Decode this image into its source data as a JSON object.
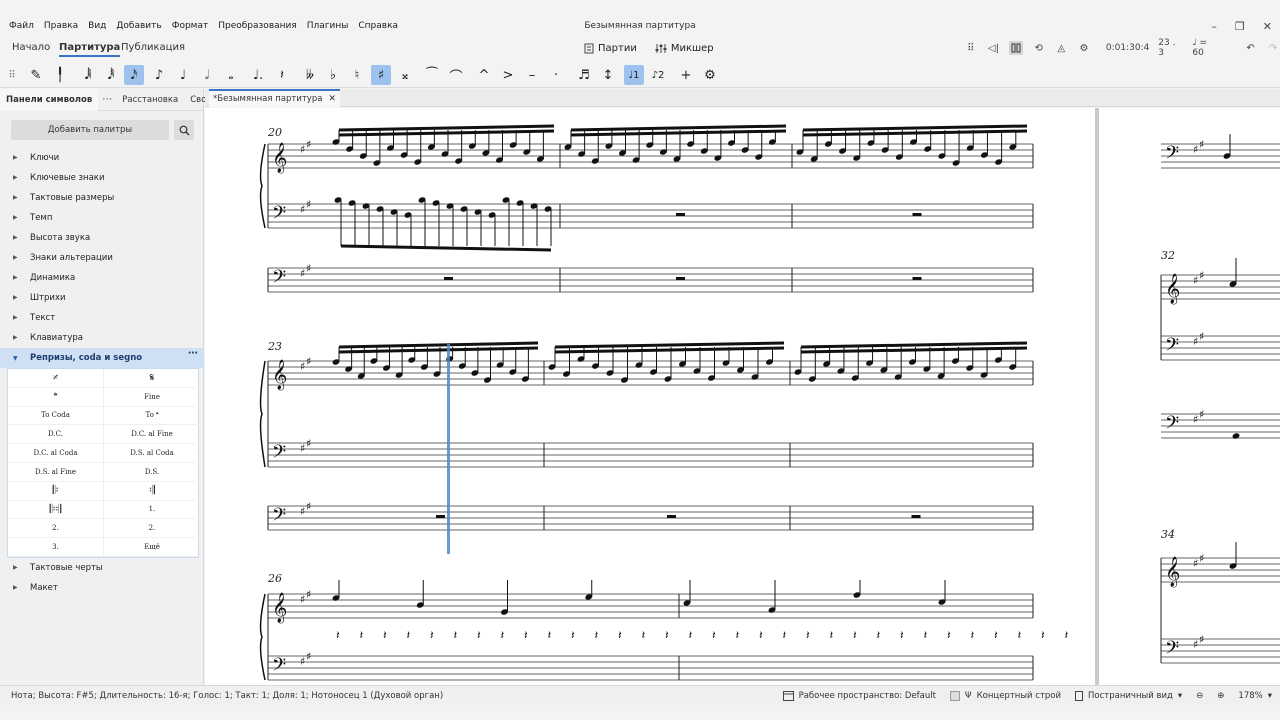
{
  "menu": [
    "Файл",
    "Правка",
    "Вид",
    "Добавить",
    "Формат",
    "Преобразования",
    "Плагины",
    "Справка"
  ],
  "window_title": "Безымянная партитура",
  "workspace_tabs": [
    "Начало",
    "Партитура",
    "Публикация"
  ],
  "center_buttons": {
    "parts": "Партии",
    "mixer": "Микшер"
  },
  "playback": {
    "time": "0:01:30:4",
    "position": "23 . 3",
    "tempo": "♩ = 60"
  },
  "panel_tabs": [
    "Панели символов",
    "Расстановка",
    "Свойства"
  ],
  "add_palettes": "Добавить палитры",
  "palettes": [
    "Ключи",
    "Ключевые знаки",
    "Тактовые размеры",
    "Темп",
    "Высота звука",
    "Знаки альтерации",
    "Динамика",
    "Штрихи",
    "Текст",
    "Клавиатура"
  ],
  "open_palette": "Репризы, coda и segno",
  "palette_cells": [
    "𝄎",
    "𝄋",
    "𝄌",
    "Fine",
    "To Coda",
    "To 𝄌",
    "D.C.",
    "D.C. al Fine",
    "D.C. al Coda",
    "D.S. al Coda",
    "D.S. al Fine",
    "D.S.",
    "𝄆",
    "𝄇",
    "𝄆𝄇",
    "1.",
    "2.",
    "2.",
    "3.",
    "Ещё"
  ],
  "palettes_after": [
    "Тактовые черты",
    "Макет"
  ],
  "doc_tab": "*Безымянная партитура",
  "measure_numbers": [
    "20",
    "23",
    "26",
    "32",
    "34"
  ],
  "status": {
    "text": "Нота; Высота: F#5; Длительность: 16-я; Голос: 1; Такт: 1; Доля: 1; Нотоносец 1 (Духовой орган)",
    "workspace": "Рабочее пространство: Default",
    "concert_pitch": "Концертный строй",
    "view": "Постраничный вид",
    "zoom": "178%"
  }
}
